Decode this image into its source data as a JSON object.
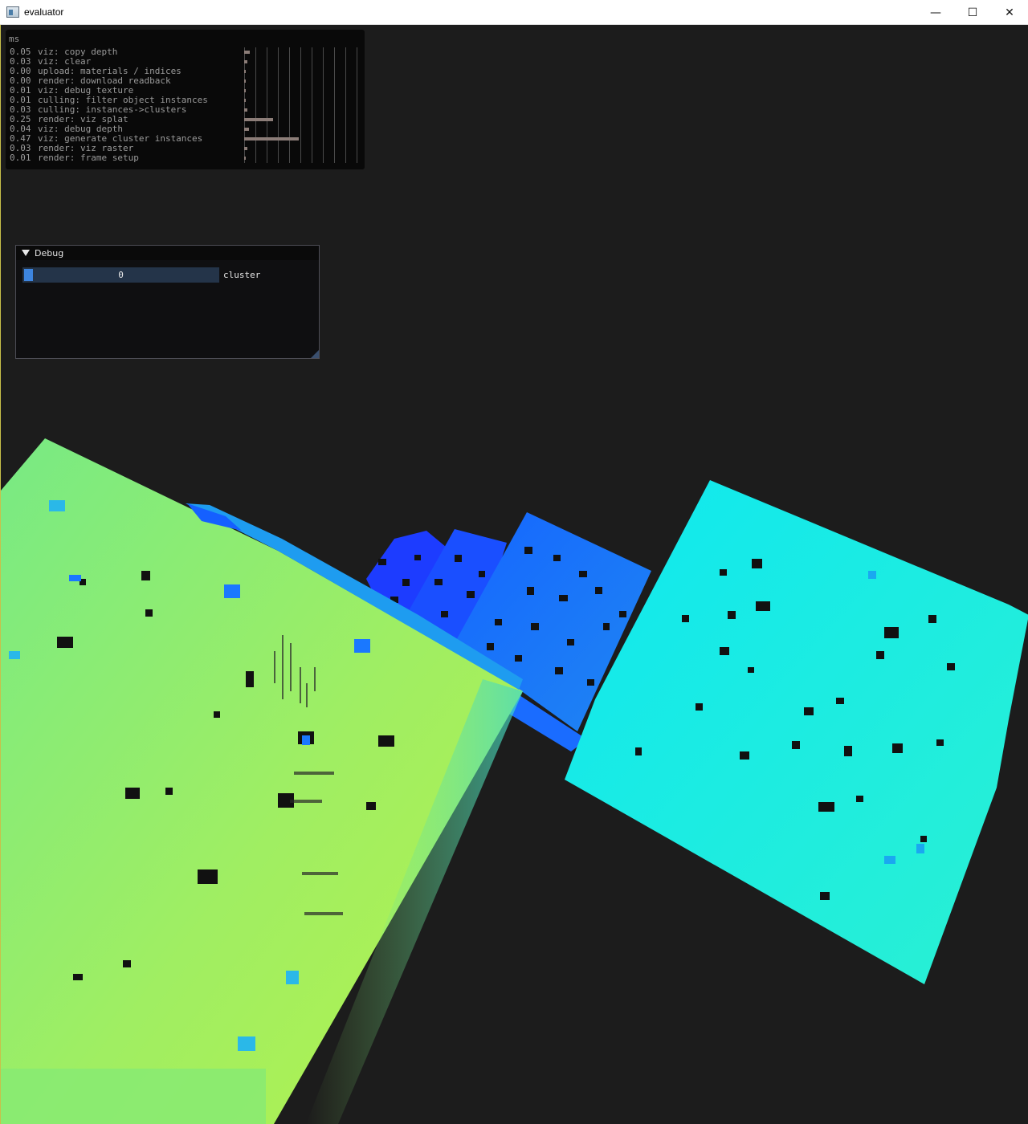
{
  "window": {
    "title": "evaluator",
    "icon": "app-window-icon",
    "controls": {
      "minimize": "—",
      "maximize": "☐",
      "close": "✕"
    }
  },
  "profiler": {
    "unit": "ms",
    "rows": [
      {
        "ms": "0.05",
        "label": "viz: copy depth",
        "value": 0.05
      },
      {
        "ms": "0.03",
        "label": "viz: clear",
        "value": 0.03
      },
      {
        "ms": "0.00",
        "label": "upload: materials / indices",
        "value": 0.0
      },
      {
        "ms": "0.00",
        "label": "render: download readback",
        "value": 0.0
      },
      {
        "ms": "0.01",
        "label": "viz: debug texture",
        "value": 0.01
      },
      {
        "ms": "0.01",
        "label": "culling: filter object instances",
        "value": 0.01
      },
      {
        "ms": "0.03",
        "label": "culling: instances->clusters",
        "value": 0.03
      },
      {
        "ms": "0.25",
        "label": "render: viz splat",
        "value": 0.25
      },
      {
        "ms": "0.04",
        "label": "viz: debug depth",
        "value": 0.04
      },
      {
        "ms": "0.47",
        "label": "viz: generate cluster instances",
        "value": 0.47
      },
      {
        "ms": "0.03",
        "label": "render: viz raster",
        "value": 0.03
      },
      {
        "ms": "0.01",
        "label": "render: frame setup",
        "value": 0.01
      }
    ],
    "bar_color": "#8c7d78"
  },
  "debug": {
    "title": "Debug",
    "slider": {
      "value": "0",
      "label": "cluster",
      "fill": 0.0
    },
    "accent": "#3d85e0"
  },
  "scene": {
    "background": "#1c1c1c",
    "colors": {
      "near_cube": "#a4f05a",
      "right_cube": "#19f0e0",
      "mid_cube": "#1a78ff",
      "far_cubes": "#1d3cff"
    }
  }
}
